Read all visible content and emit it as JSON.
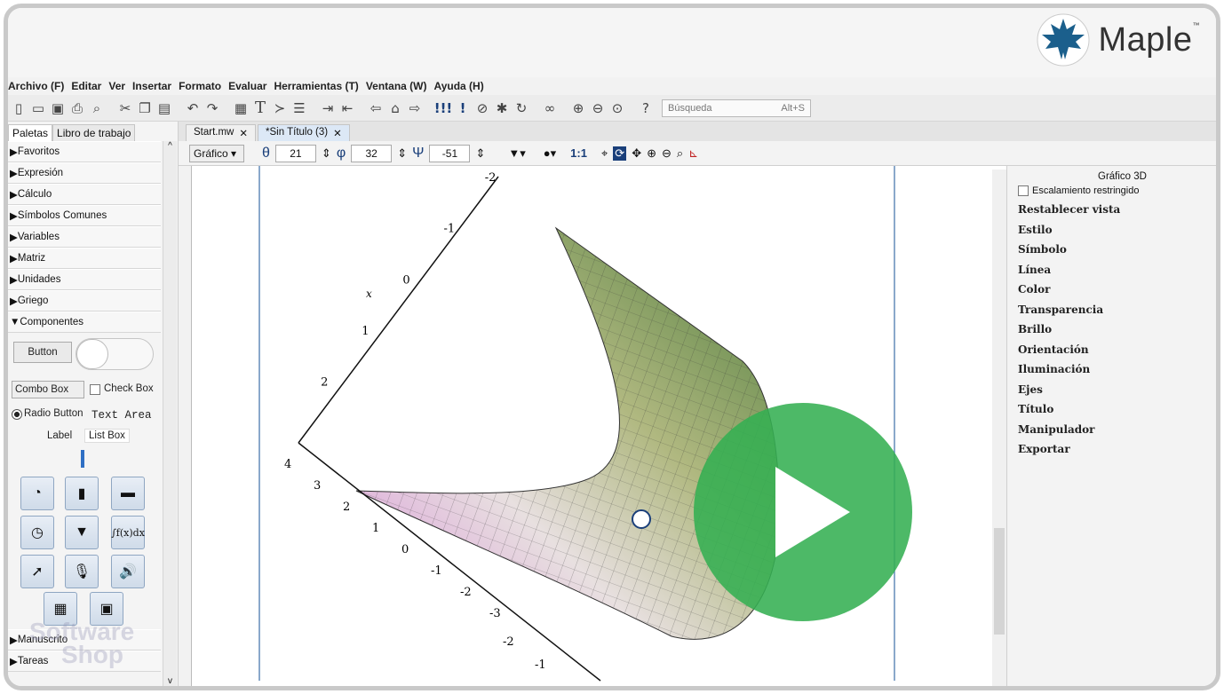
{
  "app": {
    "name": "Maple",
    "trademark": "™"
  },
  "menu": [
    "Archivo (F)",
    "Editar",
    "Ver",
    "Insertar",
    "Formato",
    "Evaluar",
    "Herramientas (T)",
    "Ventana (W)",
    "Ayuda (H)"
  ],
  "search": {
    "placeholder": "Búsqueda",
    "shortcut": "Alt+S"
  },
  "left_tabs": [
    "Paletas",
    "Libro de trabajo"
  ],
  "palettes": [
    "Favoritos",
    "Expresión",
    "Cálculo",
    "Símbolos Comunes",
    "Variables",
    "Matriz",
    "Unidades",
    "Griego",
    "Componentes"
  ],
  "palettes_bottom": [
    "Manuscrito",
    "Tareas"
  ],
  "components": {
    "button": "Button",
    "combo": "Combo Box",
    "check": "Check Box",
    "radio": "Radio Button",
    "textarea": "Text Area",
    "label": "Label",
    "listbox": "List Box"
  },
  "doc_tabs": [
    "Start.mw",
    "*Sin Título (3)"
  ],
  "plot_toolbar": {
    "dropdown": "Gráfico",
    "theta": "21",
    "phi": "32",
    "psi": "-51",
    "ratio": "1:1",
    "theta_sym": "θ",
    "phi_sym": "φ",
    "psi_sym": "Ψ"
  },
  "right_panel": {
    "title": "Gráfico 3D",
    "checkbox": "Escalamiento restringido",
    "items": [
      "Restablecer vista",
      "Estilo",
      "Símbolo",
      "Línea",
      "Color",
      "Transparencia",
      "Brillo",
      "Orientación",
      "Iluminación",
      "Ejes",
      "Título",
      "Manipulador",
      "Exportar"
    ]
  },
  "axes": {
    "x_label": "x",
    "x_ticks": [
      "-2",
      "-1",
      "0",
      "1",
      "2"
    ],
    "y_ticks": [
      "4",
      "3",
      "2",
      "1",
      "0",
      "-1",
      "-2",
      "-3"
    ],
    "z_ticks": [
      "-2",
      "-1"
    ]
  },
  "watermark": {
    "line1": "Software",
    "line2": "Shop"
  },
  "colors": {
    "accent": "#34af52",
    "brand": "#1b5f8c"
  }
}
